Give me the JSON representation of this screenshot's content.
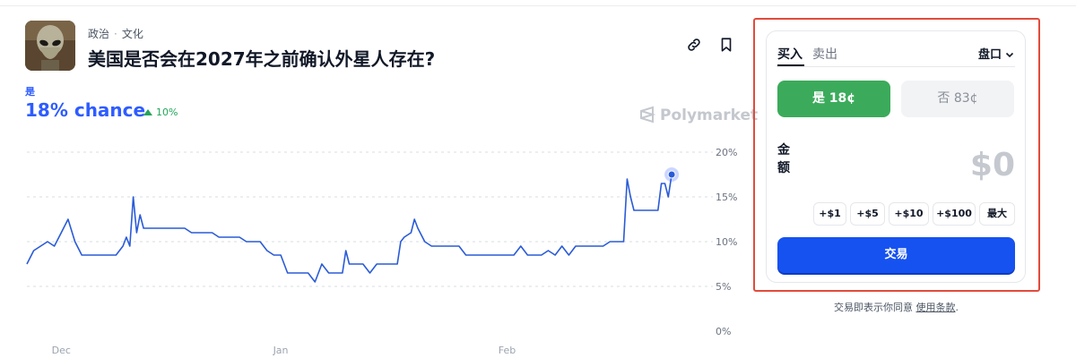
{
  "market": {
    "breadcrumb": [
      "政治",
      "文化"
    ],
    "title": "美国是否会在2027年之前确认外星人存在?",
    "outcome_label": "是",
    "chance_text": "18% chance",
    "change_text": "10%",
    "brand": "Polymarket"
  },
  "header_icons": [
    "link-icon",
    "bookmark-icon"
  ],
  "trade_panel": {
    "tabs": {
      "buy": "买入",
      "sell": "卖出"
    },
    "order_type": "盘口",
    "yes_button": "是 18¢",
    "no_button": "否 83¢",
    "amount_label": "金额",
    "amount_value": "$0",
    "quick_amounts": [
      "+$1",
      "+$5",
      "+$10",
      "+$100",
      "最大"
    ],
    "trade_button": "交易",
    "terms_prefix": "交易即表示你同意 ",
    "terms_link": "使用条款",
    "terms_suffix": "."
  },
  "colors": {
    "accent": "#2e5cff",
    "line": "#2a5bd7",
    "yes": "#3bab5b",
    "trade": "#1652f0",
    "highlight": "#e24b3c"
  },
  "chart_data": {
    "type": "line",
    "x_ticks": [
      "Dec",
      "Jan",
      "Feb"
    ],
    "y_ticks": [
      "0%",
      "5%",
      "10%",
      "15%",
      "20%"
    ],
    "ylim": [
      0,
      20
    ],
    "x_domain": [
      0,
      100
    ],
    "x_tick_positions": [
      5,
      37,
      70
    ],
    "grid": true,
    "series": [
      {
        "values": [
          [
            0,
            7.5
          ],
          [
            1,
            9
          ],
          [
            2,
            9.5
          ],
          [
            3,
            10
          ],
          [
            4,
            9.5
          ],
          [
            5,
            11
          ],
          [
            6,
            12.5
          ],
          [
            7,
            10
          ],
          [
            8,
            8.5
          ],
          [
            9,
            8.5
          ],
          [
            10,
            8.5
          ],
          [
            11,
            8.5
          ],
          [
            12,
            8.5
          ],
          [
            13,
            8.5
          ],
          [
            14,
            9.5
          ],
          [
            14.5,
            10.5
          ],
          [
            15,
            9.5
          ],
          [
            15.5,
            15
          ],
          [
            16,
            11
          ],
          [
            16.5,
            13
          ],
          [
            17,
            11.5
          ],
          [
            18,
            11.5
          ],
          [
            19,
            11.5
          ],
          [
            20,
            11.5
          ],
          [
            21,
            11.5
          ],
          [
            22,
            11.5
          ],
          [
            23,
            11.5
          ],
          [
            24,
            11
          ],
          [
            25,
            11
          ],
          [
            26,
            11
          ],
          [
            27,
            11
          ],
          [
            28,
            10.5
          ],
          [
            29,
            10.5
          ],
          [
            30,
            10.5
          ],
          [
            31,
            10.5
          ],
          [
            32,
            10
          ],
          [
            33,
            10
          ],
          [
            34,
            10
          ],
          [
            35,
            9
          ],
          [
            36,
            8.5
          ],
          [
            37,
            8.5
          ],
          [
            38,
            6.5
          ],
          [
            39,
            6.5
          ],
          [
            40,
            6.5
          ],
          [
            41,
            6.5
          ],
          [
            42,
            5.5
          ],
          [
            43,
            7.5
          ],
          [
            44,
            6.5
          ],
          [
            45,
            6.5
          ],
          [
            46,
            6.5
          ],
          [
            46.5,
            9
          ],
          [
            47,
            7.5
          ],
          [
            48,
            7.5
          ],
          [
            49,
            7.5
          ],
          [
            50,
            6.5
          ],
          [
            51,
            7.5
          ],
          [
            52,
            7.5
          ],
          [
            53,
            7.5
          ],
          [
            54,
            7.5
          ],
          [
            54.5,
            10
          ],
          [
            55,
            10.5
          ],
          [
            56,
            11
          ],
          [
            56.5,
            12.5
          ],
          [
            57,
            11.5
          ],
          [
            58,
            10
          ],
          [
            59,
            9.5
          ],
          [
            60,
            9.5
          ],
          [
            61,
            9.5
          ],
          [
            62,
            9.5
          ],
          [
            63,
            9.5
          ],
          [
            64,
            8.5
          ],
          [
            65,
            8.5
          ],
          [
            66,
            8.5
          ],
          [
            67,
            8.5
          ],
          [
            68,
            8.5
          ],
          [
            69,
            8.5
          ],
          [
            70,
            8.5
          ],
          [
            71,
            8.5
          ],
          [
            72,
            9.5
          ],
          [
            73,
            8.5
          ],
          [
            74,
            8.5
          ],
          [
            75,
            8.5
          ],
          [
            76,
            9
          ],
          [
            77,
            8.5
          ],
          [
            78,
            9.5
          ],
          [
            79,
            8.5
          ],
          [
            80,
            9.5
          ],
          [
            81,
            9.5
          ],
          [
            82,
            9.5
          ],
          [
            83,
            9.5
          ],
          [
            84,
            9.5
          ],
          [
            85,
            10
          ],
          [
            86,
            10
          ],
          [
            87,
            10
          ],
          [
            87.5,
            17
          ],
          [
            88,
            15
          ],
          [
            88.5,
            13.5
          ],
          [
            89,
            13.5
          ],
          [
            90,
            13.5
          ],
          [
            91,
            13.5
          ],
          [
            92,
            13.5
          ],
          [
            92.5,
            16.5
          ],
          [
            93,
            16.5
          ],
          [
            93.5,
            15
          ],
          [
            94,
            17.5
          ]
        ]
      }
    ]
  }
}
